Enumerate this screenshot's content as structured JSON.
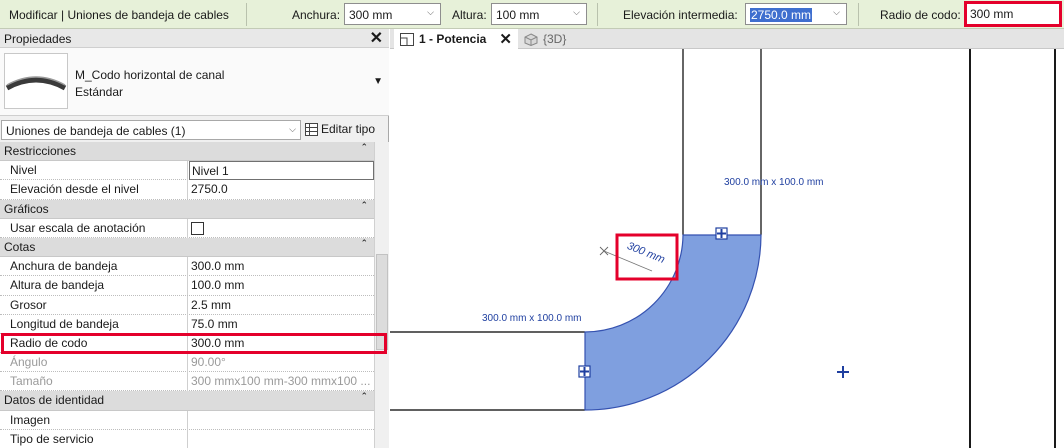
{
  "options_bar": {
    "context_title": "Modificar | Uniones de bandeja de cables",
    "width_label": "Anchura:",
    "width_value": "300 mm",
    "height_label": "Altura:",
    "height_value": "100 mm",
    "mid_elev_label": "Elevación intermedia:",
    "mid_elev_value": "2750.0 mm",
    "bend_radius_label": "Radio de codo:",
    "bend_radius_value": "300 mm"
  },
  "properties": {
    "title": "Propiedades",
    "close_icon": "close-icon",
    "type_name": "M_Codo horizontal de canal",
    "type_subname": "Estándar",
    "filter_value": "Uniones de bandeja de cables (1)",
    "edit_type_label": "Editar tipo",
    "groups": [
      {
        "label": "Restricciones",
        "rows": [
          {
            "name": "Nivel",
            "value": "Nivel 1"
          },
          {
            "name": "Elevación desde el nivel",
            "value": "2750.0"
          }
        ]
      },
      {
        "label": "Gráficos",
        "rows": [
          {
            "name": "Usar escala de anotación",
            "value": ""
          }
        ]
      },
      {
        "label": "Cotas",
        "rows": [
          {
            "name": "Anchura de bandeja",
            "value": "300.0 mm"
          },
          {
            "name": "Altura de bandeja",
            "value": "100.0 mm"
          },
          {
            "name": "Grosor",
            "value": "2.5 mm"
          },
          {
            "name": "Longitud de bandeja",
            "value": "75.0 mm"
          },
          {
            "name": "Radio de codo",
            "value": "300.0 mm"
          },
          {
            "name": "Ángulo",
            "value": "90.00°"
          },
          {
            "name": "Tamaño",
            "value": "300 mmx100 mm-300 mmx100 ..."
          }
        ]
      },
      {
        "label": "Datos de identidad",
        "rows": [
          {
            "name": "Imagen",
            "value": ""
          },
          {
            "name": "Tipo de servicio",
            "value": ""
          }
        ]
      }
    ]
  },
  "view_tabs": [
    {
      "label": "1 - Potencia",
      "icon": "floor-plan-icon"
    },
    {
      "label": "{3D}",
      "icon": "3d-view-icon"
    }
  ],
  "canvas": {
    "dim_top": "300.0 mm x 100.0 mm",
    "dim_left": "300.0 mm x 100.0 mm",
    "radius_dim": "300 mm",
    "accent_fill": "#7f9fdf",
    "annotation_color": "#1f3fa0",
    "highlight_color": "#e4002b"
  }
}
